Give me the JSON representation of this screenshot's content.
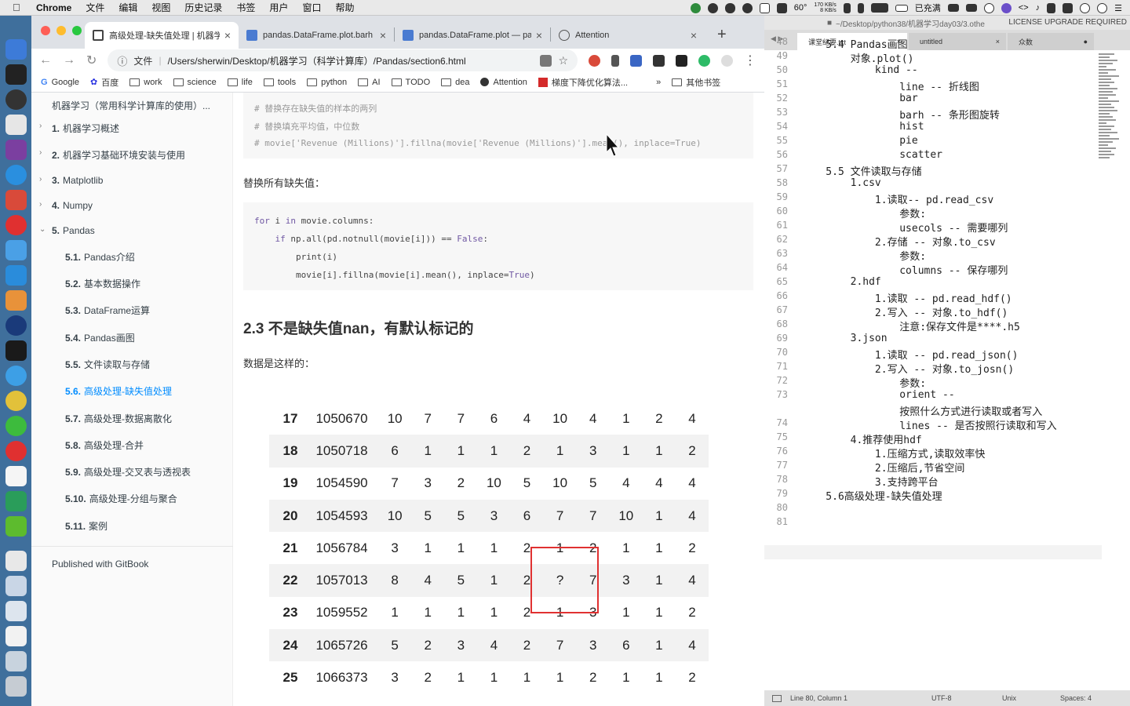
{
  "menubar": {
    "app": "Chrome",
    "items": [
      "文件",
      "编辑",
      "视图",
      "历史记录",
      "书签",
      "用户",
      "窗口",
      "帮助"
    ],
    "temp": "60°",
    "net_up": "170 KB/s",
    "net_down": "8 KB/s",
    "battery": "已充满"
  },
  "browser": {
    "tabs": [
      {
        "title": "高级处理-缺失值处理 | 机器学",
        "active": true
      },
      {
        "title": "pandas.DataFrame.plot.barh",
        "active": false
      },
      {
        "title": "pandas.DataFrame.plot — pa",
        "active": false
      },
      {
        "title": "Attention",
        "active": false
      }
    ],
    "address": {
      "scheme": "文件",
      "url": "/Users/sherwin/Desktop/机器学习（科学计算库）/Pandas/section6.html"
    },
    "bookmarks": [
      "Google",
      "百度",
      "work",
      "science",
      "life",
      "tools",
      "python",
      "AI",
      "TODO",
      "dea",
      "Attention",
      "梯度下降优化算法...",
      "»",
      "其他书签"
    ]
  },
  "sidebar": {
    "title": "机器学习（常用科学计算库的使用）...",
    "items": [
      {
        "num": "1.",
        "label": "机器学习概述",
        "level": 1,
        "arrow": "›"
      },
      {
        "num": "2.",
        "label": "机器学习基础环境安装与使用",
        "level": 1,
        "arrow": "›"
      },
      {
        "num": "3.",
        "label": "Matplotlib",
        "level": 1,
        "arrow": "›"
      },
      {
        "num": "4.",
        "label": "Numpy",
        "level": 1,
        "arrow": "›"
      },
      {
        "num": "5.",
        "label": "Pandas",
        "level": 1,
        "arrow": "⌄"
      },
      {
        "num": "5.1.",
        "label": "Pandas介绍",
        "level": 2,
        "arrow": ""
      },
      {
        "num": "5.2.",
        "label": "基本数据操作",
        "level": 2,
        "arrow": ""
      },
      {
        "num": "5.3.",
        "label": "DataFrame运算",
        "level": 2,
        "arrow": ""
      },
      {
        "num": "5.4.",
        "label": "Pandas画图",
        "level": 2,
        "arrow": ""
      },
      {
        "num": "5.5.",
        "label": "文件读取与存储",
        "level": 2,
        "arrow": ""
      },
      {
        "num": "5.6.",
        "label": "高级处理-缺失值处理",
        "level": 2,
        "arrow": "",
        "active": true
      },
      {
        "num": "5.7.",
        "label": "高级处理-数据离散化",
        "level": 2,
        "arrow": ""
      },
      {
        "num": "5.8.",
        "label": "高级处理-合并",
        "level": 2,
        "arrow": ""
      },
      {
        "num": "5.9.",
        "label": "高级处理-交叉表与透视表",
        "level": 2,
        "arrow": ""
      },
      {
        "num": "5.10.",
        "label": "高级处理-分组与聚合",
        "level": 2,
        "arrow": ""
      },
      {
        "num": "5.11.",
        "label": "案例",
        "level": 2,
        "arrow": ""
      }
    ],
    "footer": "Published with GitBook"
  },
  "article": {
    "code1": [
      "# 替换存在缺失值的样本的两列",
      "# 替换填充平均值，中位数",
      "# movie['Revenue (Millions)'].fillna(movie['Revenue (Millions)'].mean(), inplace=True)"
    ],
    "para1": "替换所有缺失值：",
    "code2": [
      "for i in movie.columns:",
      "    if np.all(pd.notnull(movie[i])) == False:",
      "        print(i)",
      "        movie[i].fillna(movie[i].mean(), inplace=True)"
    ],
    "heading": "2.3 不是缺失值nan，有默认标记的",
    "para2": "数据是这样的：",
    "table": [
      [
        "17",
        "1050670",
        "10",
        "7",
        "7",
        "6",
        "4",
        "10",
        "4",
        "1",
        "2",
        "4"
      ],
      [
        "18",
        "1050718",
        "6",
        "1",
        "1",
        "1",
        "2",
        "1",
        "3",
        "1",
        "1",
        "2"
      ],
      [
        "19",
        "1054590",
        "7",
        "3",
        "2",
        "10",
        "5",
        "10",
        "5",
        "4",
        "4",
        "4"
      ],
      [
        "20",
        "1054593",
        "10",
        "5",
        "5",
        "3",
        "6",
        "7",
        "7",
        "10",
        "1",
        "4"
      ],
      [
        "21",
        "1056784",
        "3",
        "1",
        "1",
        "1",
        "2",
        "1",
        "2",
        "1",
        "1",
        "2"
      ],
      [
        "22",
        "1057013",
        "8",
        "4",
        "5",
        "1",
        "2",
        "?",
        "7",
        "3",
        "1",
        "4"
      ],
      [
        "23",
        "1059552",
        "1",
        "1",
        "1",
        "1",
        "2",
        "1",
        "3",
        "1",
        "1",
        "2"
      ],
      [
        "24",
        "1065726",
        "5",
        "2",
        "3",
        "4",
        "2",
        "7",
        "3",
        "6",
        "1",
        "4"
      ],
      [
        "25",
        "1066373",
        "3",
        "2",
        "1",
        "1",
        "1",
        "1",
        "2",
        "1",
        "1",
        "2"
      ]
    ]
  },
  "editor": {
    "title": "~/Desktop/python38/机器学习day03/3.othe",
    "license": "LICENSE UPGRADE REQUIRED",
    "tabs": [
      "课堂纪要.txt",
      "untitled",
      "众数"
    ],
    "lines": [
      {
        "n": "48",
        "t": "    5.4 Pandas画图"
      },
      {
        "n": "49",
        "t": "        对象.plot()"
      },
      {
        "n": "50",
        "t": "            kind --"
      },
      {
        "n": "51",
        "t": "                line -- 折线图"
      },
      {
        "n": "52",
        "t": "                bar"
      },
      {
        "n": "53",
        "t": "                barh -- 条形图旋转"
      },
      {
        "n": "54",
        "t": "                hist"
      },
      {
        "n": "55",
        "t": "                pie"
      },
      {
        "n": "56",
        "t": "                scatter"
      },
      {
        "n": "57",
        "t": "    5.5 文件读取与存储"
      },
      {
        "n": "58",
        "t": "        1.csv"
      },
      {
        "n": "59",
        "t": "            1.读取-- pd.read_csv"
      },
      {
        "n": "60",
        "t": "                参数:"
      },
      {
        "n": "61",
        "t": "                usecols -- 需要哪列"
      },
      {
        "n": "62",
        "t": "            2.存储 -- 对象.to_csv"
      },
      {
        "n": "63",
        "t": "                参数:"
      },
      {
        "n": "64",
        "t": "                columns -- 保存哪列"
      },
      {
        "n": "65",
        "t": "        2.hdf"
      },
      {
        "n": "66",
        "t": "            1.读取 -- pd.read_hdf()"
      },
      {
        "n": "67",
        "t": "            2.写入 -- 对象.to_hdf()"
      },
      {
        "n": "68",
        "t": "                注意:保存文件是****.h5"
      },
      {
        "n": "69",
        "t": "        3.json"
      },
      {
        "n": "70",
        "t": "            1.读取 -- pd.read_json()"
      },
      {
        "n": "71",
        "t": "            2.写入 -- 对象.to_josn()"
      },
      {
        "n": "72",
        "t": "                参数:"
      },
      {
        "n": "73",
        "t": "                orient --"
      },
      {
        "n": "",
        "t": "                按照什么方式进行读取或者写入"
      },
      {
        "n": "74",
        "t": "                lines -- 是否按照行读取和写入"
      },
      {
        "n": "75",
        "t": "        4.推荐使用hdf"
      },
      {
        "n": "76",
        "t": "            1.压缩方式,读取效率快"
      },
      {
        "n": "77",
        "t": "            2.压缩后,节省空间"
      },
      {
        "n": "78",
        "t": "            3.支持跨平台"
      },
      {
        "n": "79",
        "t": "    5.6高级处理-缺失值处理"
      },
      {
        "n": "80",
        "t": ""
      },
      {
        "n": "81",
        "t": ""
      }
    ],
    "status": {
      "position": "Line 80, Column 1",
      "encoding": "UTF-8",
      "line_endings": "Unix",
      "indent": "Spaces: 4"
    }
  }
}
